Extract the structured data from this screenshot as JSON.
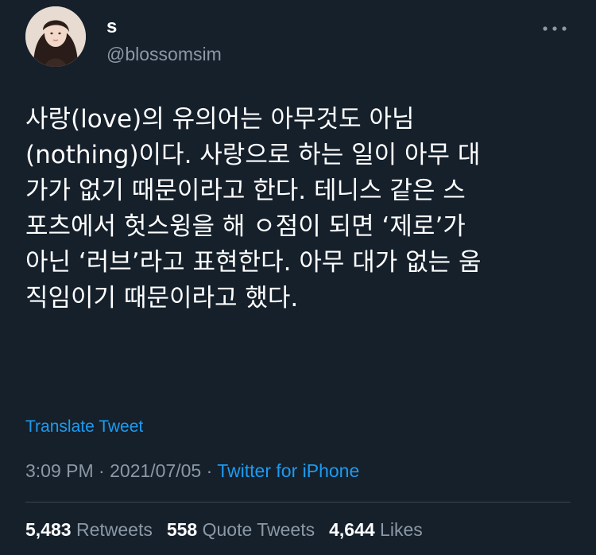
{
  "user": {
    "display_name": "s",
    "handle": "@blossomsim",
    "avatar_icon": "profile-photo"
  },
  "tweet": {
    "text_lines": [
      "사랑(love)의 유의어는 아무것도 아님",
      "(nothing)이다. 사랑으로 하는 일이 아무 대",
      "가가 없기 때문이라고 한다. 테니스 같은 스",
      "포츠에서 헛스윙을 해 ㅇ점이 되면 ‘제로’가",
      "아닌 ‘러브’라고 표현한다. 아무 대가 없는 움",
      "직임이기 때문이라고 했다."
    ]
  },
  "translate_label": "Translate Tweet",
  "meta": {
    "time": "3:09 PM",
    "separator": " · ",
    "date": "2021/07/05",
    "source": "Twitter for iPhone"
  },
  "stats": {
    "retweets_count": "5,483",
    "retweets_label": "Retweets",
    "quotes_count": "558",
    "quotes_label": "Quote Tweets",
    "likes_count": "4,644",
    "likes_label": "Likes"
  },
  "colors": {
    "background": "#15202b",
    "accent": "#1d9bf0",
    "secondary_text": "#8b98a5",
    "divider": "#38444d"
  },
  "icons": {
    "more": "more-horizontal-icon"
  }
}
